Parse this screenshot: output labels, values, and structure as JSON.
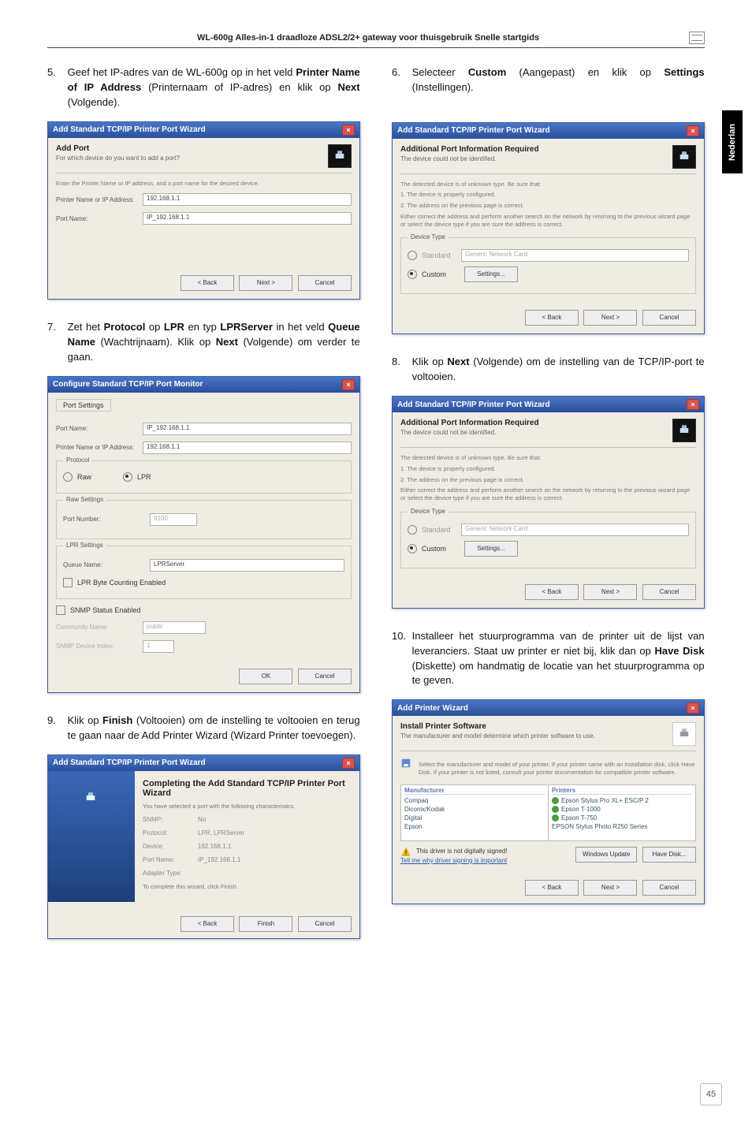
{
  "header": "WL-600g Alles-in-1 draadloze ADSL2/2+ gateway voor thuisgebruik Snelle startgids",
  "side_tab": "Nederlan",
  "page_number": "45",
  "left": {
    "step5": {
      "num": "5.",
      "text_parts": [
        "Geef het IP-adres van de WL-600g op in het veld ",
        "Printer Name of IP Address",
        " (Printernaam of IP-adres) en klik op ",
        "Next",
        " (Volgende)."
      ]
    },
    "shot5": {
      "title": "Add Standard TCP/IP Printer Port Wizard",
      "wiz_head_t": "Add Port",
      "wiz_head_sub": "For which device do you want to add a port?",
      "note": "Enter the Printer Name or IP address, and a port name for the desired device.",
      "f1_label": "Printer Name or IP Address:",
      "f1_val": "192.168.1.1",
      "f2_label": "Port Name:",
      "f2_val": "IP_192.168.1.1",
      "btn_back": "< Back",
      "btn_next": "Next >",
      "btn_cancel": "Cancel"
    },
    "step7": {
      "num": "7.",
      "text_parts": [
        "Zet het ",
        "Protocol",
        " op ",
        "LPR",
        " en typ ",
        "LPRServer",
        " in het veld ",
        "Queue Name",
        " (Wachtrijnaam). Klik op ",
        "Next",
        " (Volgende) om verder te gaan."
      ]
    },
    "shot7": {
      "title": "Configure Standard TCP/IP Port Monitor",
      "tab": "Port Settings",
      "f1_label": "Port Name:",
      "f1_val": "IP_192.168.1.1",
      "f2_label": "Printer Name or IP Address:",
      "f2_val": "192.168.1.1",
      "grp_proto": "Protocol",
      "opt_raw": "Raw",
      "opt_lpr": "LPR",
      "grp_raw": "Raw Settings",
      "raw_port_label": "Port Number:",
      "raw_port_val": "9100",
      "grp_lpr": "LPR Settings",
      "lpr_queue_label": "Queue Name:",
      "lpr_queue_val": "LPRServer",
      "chk_lpr": "LPR Byte Counting Enabled",
      "chk_snmp": "SNMP Status Enabled",
      "snmp_comm_label": "Community Name:",
      "snmp_comm_val": "public",
      "snmp_idx_label": "SNMP Device Index:",
      "snmp_idx_val": "1",
      "btn_ok": "OK",
      "btn_cancel": "Cancel"
    },
    "step9": {
      "num": "9.",
      "text_parts": [
        "Klik op ",
        "Finish",
        " (Voltooien) om de instelling te voltooien en terug te gaan naar de Add Printer Wizard (Wizard Printer toevoegen)."
      ]
    },
    "shot9": {
      "title": "Add Standard TCP/IP Printer Port Wizard",
      "main_title": "Completing the Add Standard TCP/IP Printer Port Wizard",
      "sub": "You have selected a port with the following characteristics.",
      "rows": [
        [
          "SNMP:",
          "No"
        ],
        [
          "Protocol:",
          "LPR, LPRServer"
        ],
        [
          "Device:",
          "192.168.1.1"
        ],
        [
          "Port Name:",
          "IP_192.168.1.1"
        ],
        [
          "Adapter Type:",
          ""
        ]
      ],
      "finish_note": "To complete this wizard, click Finish.",
      "btn_back": "< Back",
      "btn_finish": "Finish",
      "btn_cancel": "Cancel"
    }
  },
  "right": {
    "step6": {
      "num": "6.",
      "text_parts": [
        "Selecteer ",
        "Custom",
        " (Aangepast) en klik op ",
        "Settings",
        " (Instellingen)."
      ]
    },
    "shot6": {
      "title": "Add Standard TCP/IP Printer Port Wizard",
      "wiz_head_t": "Additional Port Information Required",
      "wiz_head_sub": "The device could not be identified.",
      "body_lines": [
        "The detected device is of unknown type. Be sure that:",
        "1. The device is properly configured.",
        "2. The address on the previous page is correct.",
        "Either correct the address and perform another search on the network by returning to the previous wizard page or select the device type if you are sure the address is correct."
      ],
      "grp": "Device Type",
      "opt_std": "Standard",
      "std_val": "Generic Network Card",
      "opt_custom": "Custom",
      "btn_settings": "Settings...",
      "btn_back": "< Back",
      "btn_next": "Next >",
      "btn_cancel": "Cancel"
    },
    "step8": {
      "num": "8.",
      "text_parts": [
        "Klik op ",
        "Next",
        " (Volgende) om de instelling van de TCP/IP-port te voltooien."
      ]
    },
    "step10": {
      "num": "10.",
      "text_parts": [
        "Installeer het stuurprogramma van de printer uit de lijst van leveranciers. Staat uw printer er niet bij, klik dan op ",
        "Have Disk",
        " (Diskette) om handmatig de locatie van het stuurprogramma op te geven."
      ]
    },
    "shot10": {
      "title": "Add Printer Wizard",
      "head_t": "Install Printer Software",
      "head_sub": "The manufacturer and model determine which printer software to use.",
      "body_note": "Select the manufacturer and model of your printer. If your printer came with an installation disk, click Have Disk. If your printer is not listed, consult your printer documentation for compatible printer software.",
      "mfr_head": "Manufacturer",
      "mfr_items": [
        "Compaq",
        "Diconix/Kodak",
        "Digital",
        "Epson"
      ],
      "prn_head": "Printers",
      "prn_items": [
        "Epson Stylus Pro XL+ ESC/P 2",
        "Epson T-1000",
        "Epson T-750",
        "EPSON Stylus Photo R250 Series"
      ],
      "signed": "This driver is not digitally signed!",
      "why": "Tell me why driver signing is important",
      "btn_wu": "Windows Update",
      "btn_hd": "Have Disk...",
      "btn_back": "< Back",
      "btn_next": "Next >",
      "btn_cancel": "Cancel"
    }
  }
}
